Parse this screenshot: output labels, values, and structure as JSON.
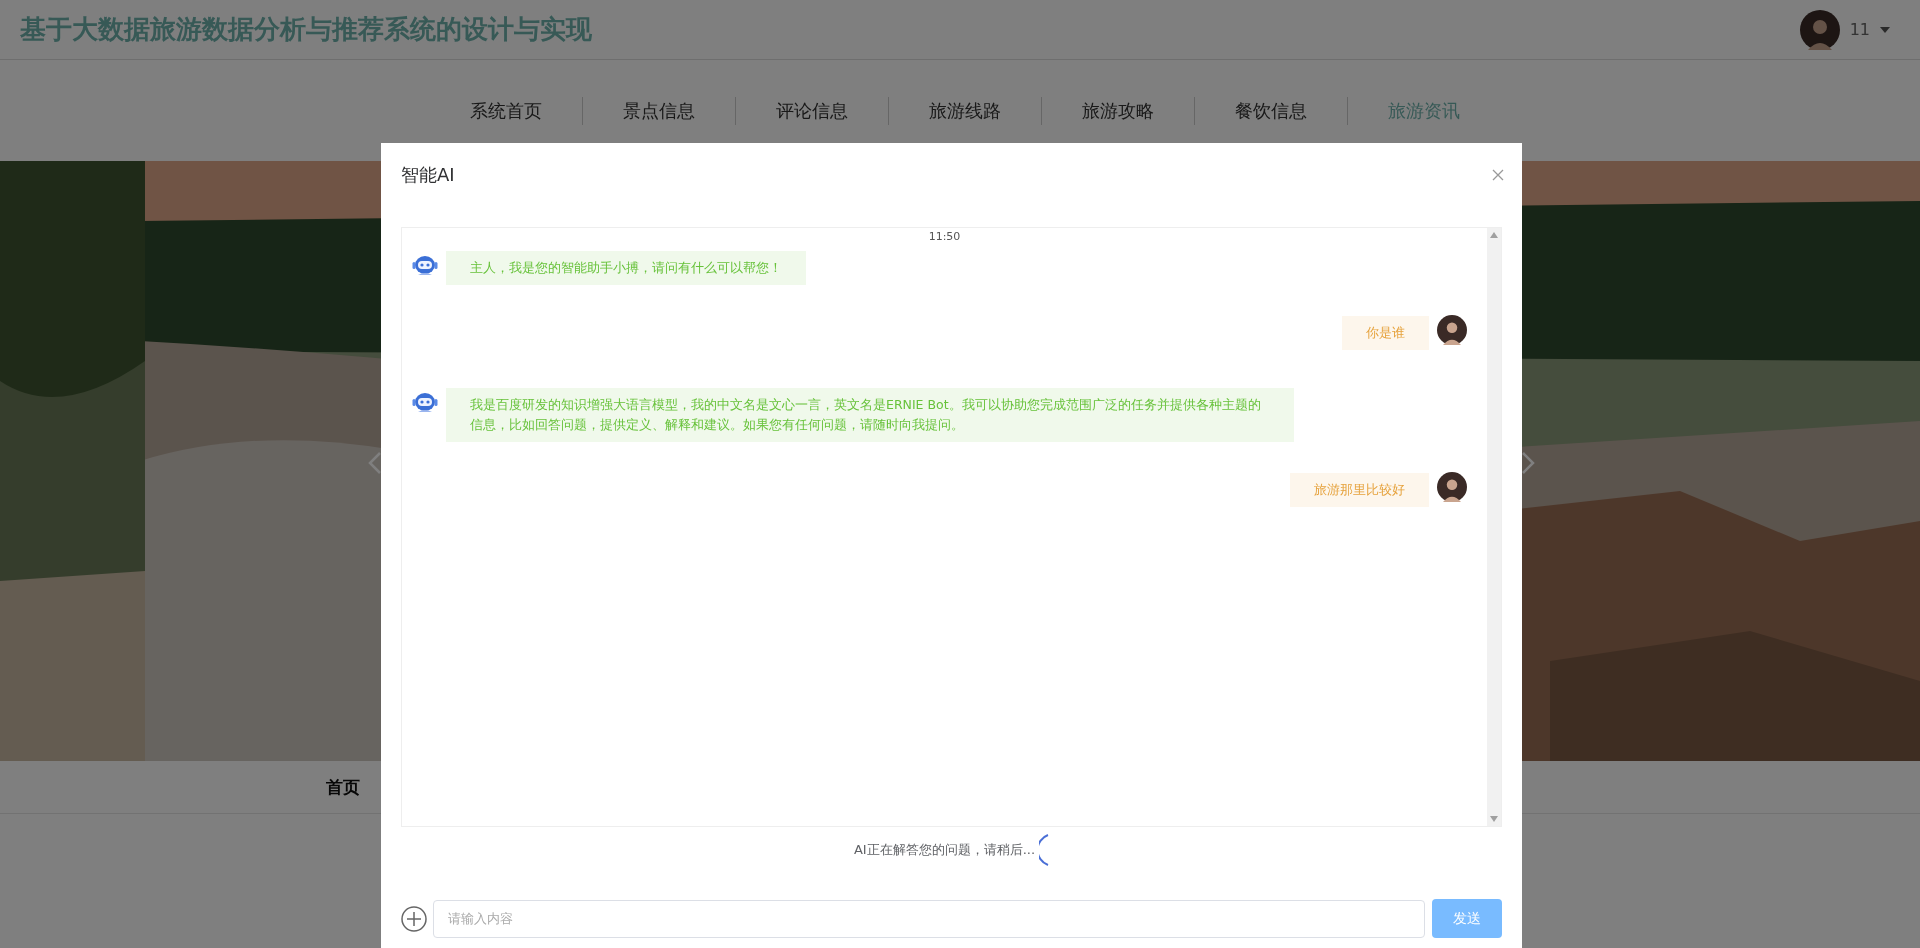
{
  "header": {
    "title": "基于大数据旅游数据分析与推荐系统的设计与实现",
    "user_name": "11"
  },
  "nav": [
    {
      "label": "系统首页",
      "selected": false
    },
    {
      "label": "景点信息",
      "selected": false
    },
    {
      "label": "评论信息",
      "selected": false
    },
    {
      "label": "旅游线路",
      "selected": false
    },
    {
      "label": "旅游攻略",
      "selected": false
    },
    {
      "label": "餐饮信息",
      "selected": false
    },
    {
      "label": "旅游资讯",
      "selected": true
    }
  ],
  "breadcrumb": "首页",
  "dialog": {
    "title": "智能AI",
    "timestamp": "11:50",
    "messages": [
      {
        "kind": "bot",
        "text": "主人，我是您的智能助手小搏，请问有什么可以帮您！"
      },
      {
        "kind": "user",
        "text": "你是谁"
      },
      {
        "kind": "bot",
        "text": "我是百度研发的知识增强大语言模型，我的中文名是文心一言，英文名是ERNIE Bot。我可以协助您完成范围广泛的任务并提供各种主题的信息，比如回答问题，提供定义、解释和建议。如果您有任何问题，请随时向我提问。"
      },
      {
        "kind": "user",
        "text": "旅游那里比较好"
      }
    ],
    "status": "AI正在解答您的问题，请稍后...",
    "input": {
      "placeholder": "请输入内容"
    },
    "send_button": "发送"
  }
}
